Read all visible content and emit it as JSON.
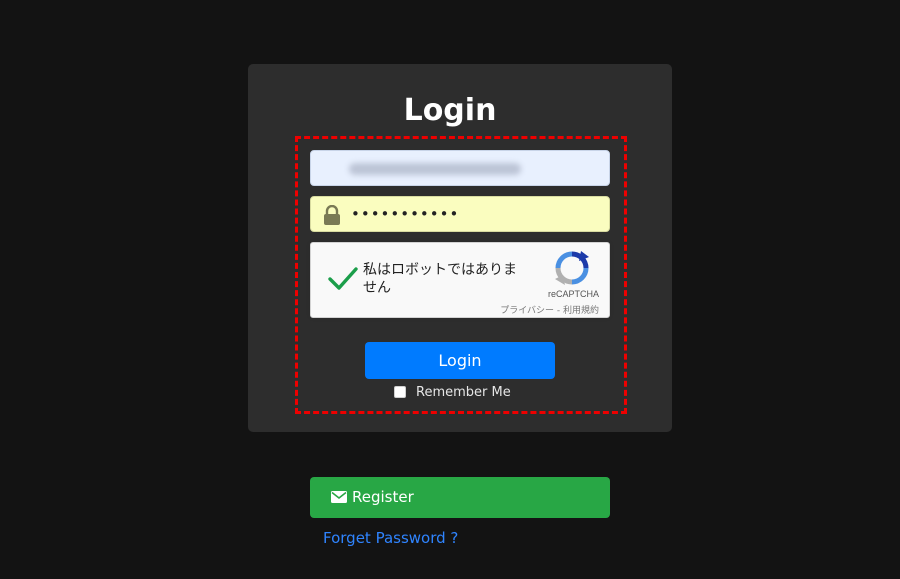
{
  "login_form": {
    "title": "Login",
    "password_masked": "•••••••••••",
    "login_button_label": "Login",
    "remember_me_label": "Remember Me"
  },
  "recaptcha": {
    "label": "私はロボットではありません",
    "brand": "reCAPTCHA",
    "terms": "プライバシー - 利用規約",
    "check_icon": "checkmark-icon",
    "logo_icon": "recaptcha-logo-icon"
  },
  "footer": {
    "register_label": "Register",
    "register_icon": "envelope-icon",
    "forgot_password_label": "Forget Password ?"
  },
  "colors": {
    "background": "#131313",
    "card": "#2d2d2d",
    "primary": "#007bff",
    "success": "#28a745",
    "link": "#2f84ff",
    "highlight": "#ee0000"
  }
}
